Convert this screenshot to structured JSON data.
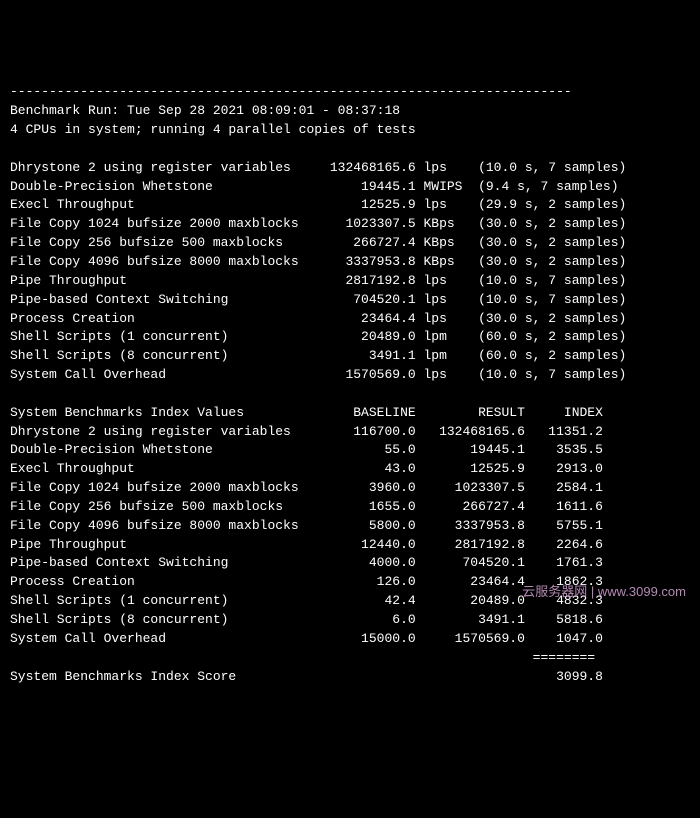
{
  "header": {
    "top_rule": "------------------------------------------------------------------------",
    "run_line": "Benchmark Run: Tue Sep 28 2021 08:09:01 - 08:37:18",
    "cpu_line": "4 CPUs in system; running 4 parallel copies of tests"
  },
  "tests": [
    {
      "name": "Dhrystone 2 using register variables",
      "value": "132468165.6",
      "unit": "lps",
      "timing": "(10.0 s, 7 samples)"
    },
    {
      "name": "Double-Precision Whetstone",
      "value": "19445.1",
      "unit": "MWIPS",
      "timing": "(9.4 s, 7 samples)"
    },
    {
      "name": "Execl Throughput",
      "value": "12525.9",
      "unit": "lps",
      "timing": "(29.9 s, 2 samples)"
    },
    {
      "name": "File Copy 1024 bufsize 2000 maxblocks",
      "value": "1023307.5",
      "unit": "KBps",
      "timing": "(30.0 s, 2 samples)"
    },
    {
      "name": "File Copy 256 bufsize 500 maxblocks",
      "value": "266727.4",
      "unit": "KBps",
      "timing": "(30.0 s, 2 samples)"
    },
    {
      "name": "File Copy 4096 bufsize 8000 maxblocks",
      "value": "3337953.8",
      "unit": "KBps",
      "timing": "(30.0 s, 2 samples)"
    },
    {
      "name": "Pipe Throughput",
      "value": "2817192.8",
      "unit": "lps",
      "timing": "(10.0 s, 7 samples)"
    },
    {
      "name": "Pipe-based Context Switching",
      "value": "704520.1",
      "unit": "lps",
      "timing": "(10.0 s, 7 samples)"
    },
    {
      "name": "Process Creation",
      "value": "23464.4",
      "unit": "lps",
      "timing": "(30.0 s, 2 samples)"
    },
    {
      "name": "Shell Scripts (1 concurrent)",
      "value": "20489.0",
      "unit": "lpm",
      "timing": "(60.0 s, 2 samples)"
    },
    {
      "name": "Shell Scripts (8 concurrent)",
      "value": "3491.1",
      "unit": "lpm",
      "timing": "(60.0 s, 2 samples)"
    },
    {
      "name": "System Call Overhead",
      "value": "1570569.0",
      "unit": "lps",
      "timing": "(10.0 s, 7 samples)"
    }
  ],
  "index_header": {
    "label": "System Benchmarks Index Values",
    "baseline": "BASELINE",
    "result": "RESULT",
    "index": "INDEX"
  },
  "index_rows": [
    {
      "name": "Dhrystone 2 using register variables",
      "baseline": "116700.0",
      "result": "132468165.6",
      "index": "11351.2"
    },
    {
      "name": "Double-Precision Whetstone",
      "baseline": "55.0",
      "result": "19445.1",
      "index": "3535.5"
    },
    {
      "name": "Execl Throughput",
      "baseline": "43.0",
      "result": "12525.9",
      "index": "2913.0"
    },
    {
      "name": "File Copy 1024 bufsize 2000 maxblocks",
      "baseline": "3960.0",
      "result": "1023307.5",
      "index": "2584.1"
    },
    {
      "name": "File Copy 256 bufsize 500 maxblocks",
      "baseline": "1655.0",
      "result": "266727.4",
      "index": "1611.6"
    },
    {
      "name": "File Copy 4096 bufsize 8000 maxblocks",
      "baseline": "5800.0",
      "result": "3337953.8",
      "index": "5755.1"
    },
    {
      "name": "Pipe Throughput",
      "baseline": "12440.0",
      "result": "2817192.8",
      "index": "2264.6"
    },
    {
      "name": "Pipe-based Context Switching",
      "baseline": "4000.0",
      "result": "704520.1",
      "index": "1761.3"
    },
    {
      "name": "Process Creation",
      "baseline": "126.0",
      "result": "23464.4",
      "index": "1862.3"
    },
    {
      "name": "Shell Scripts (1 concurrent)",
      "baseline": "42.4",
      "result": "20489.0",
      "index": "4832.3"
    },
    {
      "name": "Shell Scripts (8 concurrent)",
      "baseline": "6.0",
      "result": "3491.1",
      "index": "5818.6"
    },
    {
      "name": "System Call Overhead",
      "baseline": "15000.0",
      "result": "1570569.0",
      "index": "1047.0"
    }
  ],
  "footer": {
    "rule": "                                                                   ========",
    "score_label": "System Benchmarks Index Score",
    "score_value": "3099.8"
  },
  "watermark": "云服务器网 | www.3099.com"
}
